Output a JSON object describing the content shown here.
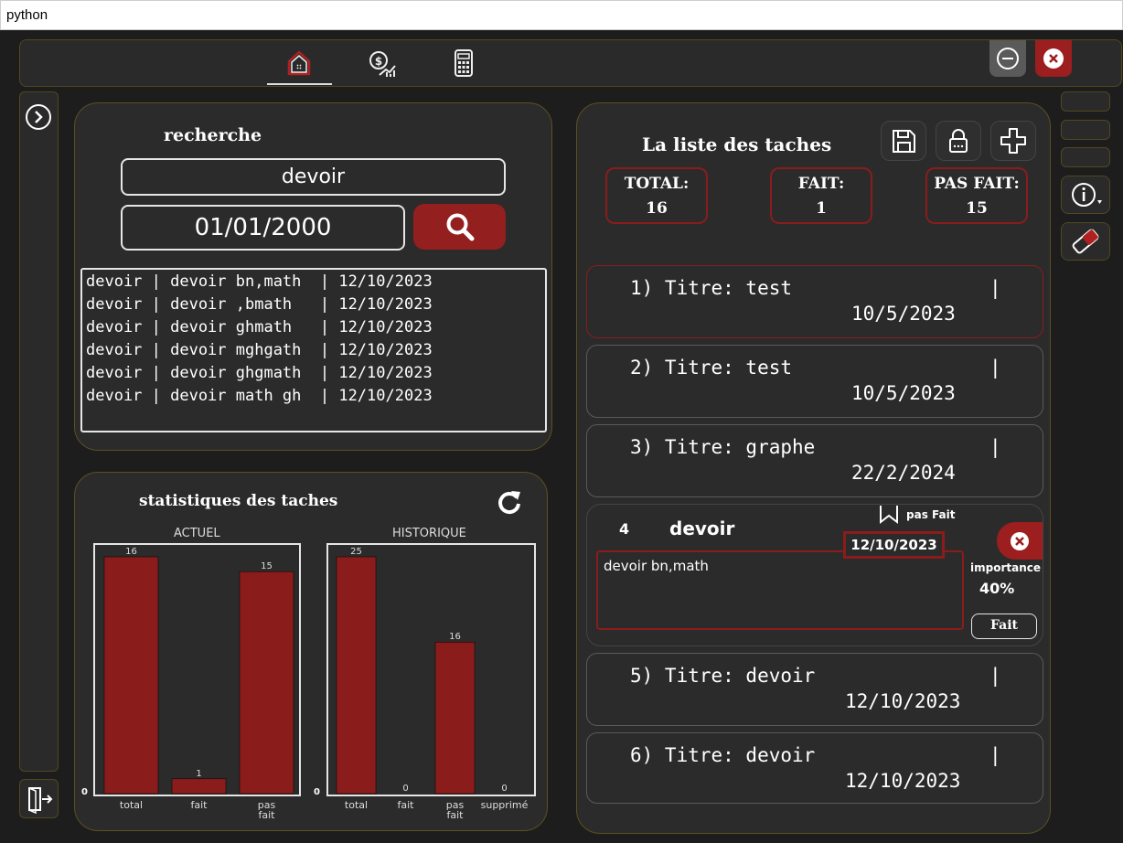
{
  "window": {
    "title": "python"
  },
  "nav": {
    "home": "home-icon",
    "finance": "finance-icon",
    "calculator": "calculator-icon"
  },
  "search": {
    "heading": "recherche",
    "query": "devoir",
    "date": "01/01/2000",
    "results": [
      "devoir | devoir bn,math  | 12/10/2023",
      "devoir | devoir ,bmath   | 12/10/2023",
      "devoir | devoir ghmath   | 12/10/2023",
      "devoir | devoir mghgath  | 12/10/2023",
      "devoir | devoir ghgmath  | 12/10/2023",
      "devoir | devoir math gh  | 12/10/2023"
    ]
  },
  "stats": {
    "heading": "statistiques des taches"
  },
  "chart_data": [
    {
      "type": "bar",
      "title": "ACTUEL",
      "categories": [
        "total",
        "fait",
        "pas fait"
      ],
      "values": [
        16,
        1,
        15
      ],
      "ylim": [
        0,
        16
      ],
      "zero_label": "0",
      "color": "#8b1c1c"
    },
    {
      "type": "bar",
      "title": "HISTORIQUE",
      "categories": [
        "total",
        "fait",
        "pas fait",
        "supprimé"
      ],
      "values": [
        25,
        0,
        16,
        0
      ],
      "ylim": [
        0,
        25
      ],
      "zero_label": "0",
      "color": "#8b1c1c"
    }
  ],
  "tasks": {
    "heading": "La liste des taches",
    "total_label": "TOTAL:",
    "total": "16",
    "done_label": "FAIT:",
    "done": "1",
    "todo_label": "PAS FAIT:",
    "todo": "15",
    "items": [
      {
        "line1": "1) Titre: test",
        "sep": "|",
        "date": "10/5/2023"
      },
      {
        "line1": "2) Titre: test",
        "sep": "|",
        "date": "10/5/2023"
      },
      {
        "line1": "3) Titre: graphe",
        "sep": "|",
        "date": "22/2/2024"
      },
      {
        "line1": "5) Titre: devoir",
        "sep": "|",
        "date": "12/10/2023"
      },
      {
        "line1": "6) Titre: devoir",
        "sep": "|",
        "date": "12/10/2023"
      }
    ],
    "expanded": {
      "number": "4",
      "title": "devoir",
      "status": "pas Fait",
      "date": "12/10/2023",
      "description": "devoir bn,math",
      "importance_label": "importance",
      "importance": "40%",
      "done_button": "Fait"
    }
  },
  "colors": {
    "accent": "#941f1f",
    "border": "#514720",
    "panel": "#2b2b2b"
  }
}
